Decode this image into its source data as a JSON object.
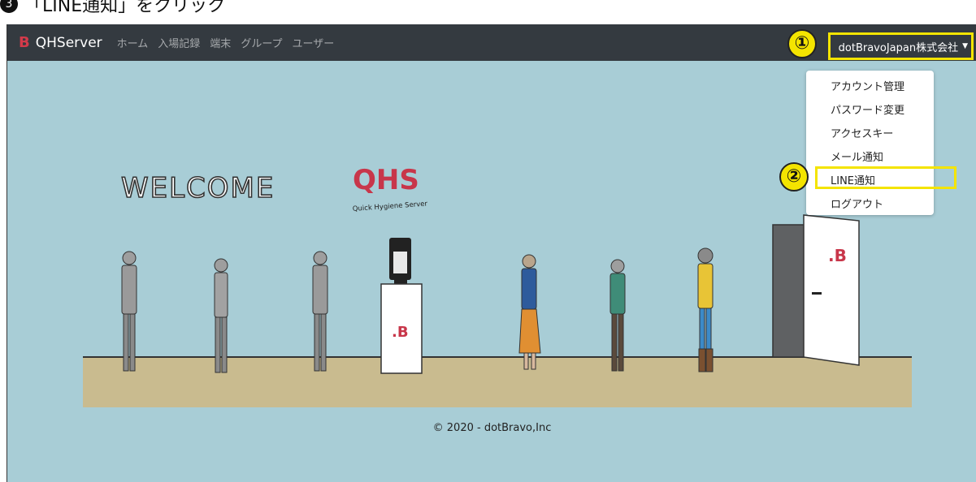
{
  "doc_heading": {
    "number": "3",
    "text": "「LINE通知」をクリック"
  },
  "navbar": {
    "brand_logo": "B",
    "brand_text": "QHServer",
    "links": [
      "ホーム",
      "入場記録",
      "端末",
      "グループ",
      "ユーザー"
    ],
    "user_menu": "dotBravoJapan株式会社"
  },
  "annotations": {
    "step1": "①",
    "step2": "②"
  },
  "dropdown": {
    "items": [
      "アカウント管理",
      "パスワード変更",
      "アクセスキー",
      "メール通知",
      "LINE通知",
      "ログアウト"
    ],
    "highlighted_index": 4
  },
  "hero": {
    "welcome": "WELCOME",
    "logo_main": "QHS",
    "logo_sub": "Quick Hygiene Server",
    "brand_mark": ".B"
  },
  "footer": {
    "copyright": "© 2020 - dotBravo,Inc"
  },
  "colors": {
    "navbar_bg": "#343a40",
    "scene_bg": "#a8cdd6",
    "floor": "#c9bb8f",
    "highlight": "#f4e400",
    "brand_red": "#c8364a"
  },
  "icons": {
    "dropdown_caret": "caret-down-icon",
    "circled_numbers": "numbered-callout-icon"
  }
}
